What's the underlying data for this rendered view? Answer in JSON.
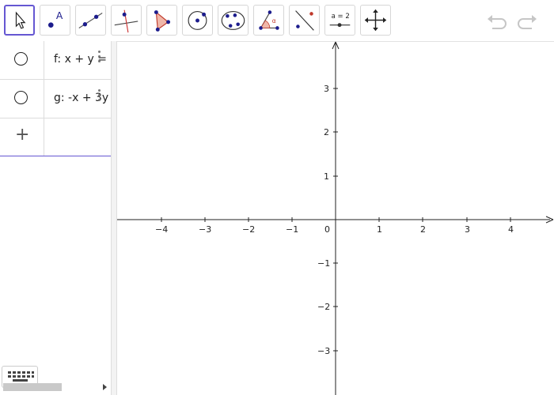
{
  "toolbar": {
    "tools": [
      {
        "name": "move-tool",
        "active": true
      },
      {
        "name": "point-tool",
        "label": "A"
      },
      {
        "name": "line-tool"
      },
      {
        "name": "perpendicular-line-tool"
      },
      {
        "name": "polygon-tool"
      },
      {
        "name": "circle-center-point-tool"
      },
      {
        "name": "conic-five-points-tool"
      },
      {
        "name": "angle-tool",
        "label": "α"
      },
      {
        "name": "reflect-tool"
      },
      {
        "name": "slider-tool",
        "label": "a = 2"
      },
      {
        "name": "move-graphics-view-tool"
      }
    ],
    "undo": "undo",
    "redo": "redo"
  },
  "algebra": {
    "items": [
      {
        "formula": "f: x + y = "
      },
      {
        "formula": "g: -x + 3y"
      }
    ],
    "add_label": "+"
  },
  "graphics": {
    "x_ticks": [
      "−4",
      "−3",
      "−2",
      "−1",
      "1",
      "2",
      "3",
      "4"
    ],
    "origin": "0",
    "y_ticks": [
      "3",
      "2",
      "1",
      "−1",
      "−2",
      "−3"
    ]
  }
}
